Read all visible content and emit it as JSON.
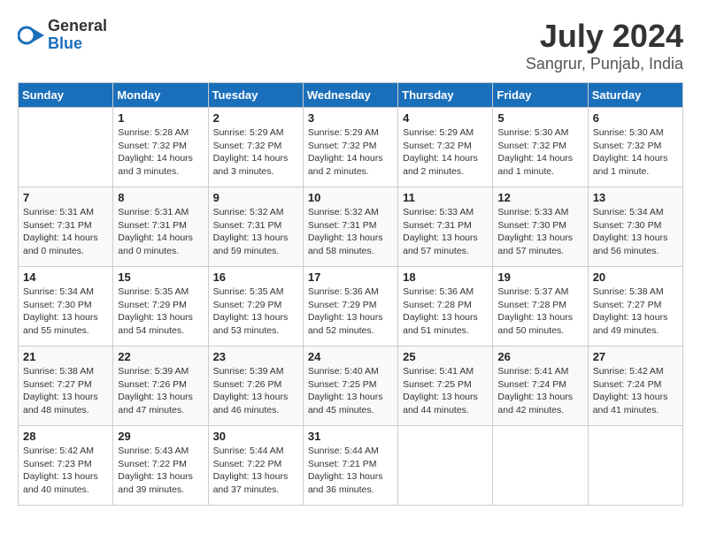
{
  "logo": {
    "general": "General",
    "blue": "Blue"
  },
  "title": "July 2024",
  "subtitle": "Sangrur, Punjab, India",
  "days_of_week": [
    "Sunday",
    "Monday",
    "Tuesday",
    "Wednesday",
    "Thursday",
    "Friday",
    "Saturday"
  ],
  "weeks": [
    [
      {
        "date": "",
        "info": ""
      },
      {
        "date": "1",
        "info": "Sunrise: 5:28 AM\nSunset: 7:32 PM\nDaylight: 14 hours\nand 3 minutes."
      },
      {
        "date": "2",
        "info": "Sunrise: 5:29 AM\nSunset: 7:32 PM\nDaylight: 14 hours\nand 3 minutes."
      },
      {
        "date": "3",
        "info": "Sunrise: 5:29 AM\nSunset: 7:32 PM\nDaylight: 14 hours\nand 2 minutes."
      },
      {
        "date": "4",
        "info": "Sunrise: 5:29 AM\nSunset: 7:32 PM\nDaylight: 14 hours\nand 2 minutes."
      },
      {
        "date": "5",
        "info": "Sunrise: 5:30 AM\nSunset: 7:32 PM\nDaylight: 14 hours\nand 1 minute."
      },
      {
        "date": "6",
        "info": "Sunrise: 5:30 AM\nSunset: 7:32 PM\nDaylight: 14 hours\nand 1 minute."
      }
    ],
    [
      {
        "date": "7",
        "info": "Sunrise: 5:31 AM\nSunset: 7:31 PM\nDaylight: 14 hours\nand 0 minutes."
      },
      {
        "date": "8",
        "info": "Sunrise: 5:31 AM\nSunset: 7:31 PM\nDaylight: 14 hours\nand 0 minutes."
      },
      {
        "date": "9",
        "info": "Sunrise: 5:32 AM\nSunset: 7:31 PM\nDaylight: 13 hours\nand 59 minutes."
      },
      {
        "date": "10",
        "info": "Sunrise: 5:32 AM\nSunset: 7:31 PM\nDaylight: 13 hours\nand 58 minutes."
      },
      {
        "date": "11",
        "info": "Sunrise: 5:33 AM\nSunset: 7:31 PM\nDaylight: 13 hours\nand 57 minutes."
      },
      {
        "date": "12",
        "info": "Sunrise: 5:33 AM\nSunset: 7:30 PM\nDaylight: 13 hours\nand 57 minutes."
      },
      {
        "date": "13",
        "info": "Sunrise: 5:34 AM\nSunset: 7:30 PM\nDaylight: 13 hours\nand 56 minutes."
      }
    ],
    [
      {
        "date": "14",
        "info": "Sunrise: 5:34 AM\nSunset: 7:30 PM\nDaylight: 13 hours\nand 55 minutes."
      },
      {
        "date": "15",
        "info": "Sunrise: 5:35 AM\nSunset: 7:29 PM\nDaylight: 13 hours\nand 54 minutes."
      },
      {
        "date": "16",
        "info": "Sunrise: 5:35 AM\nSunset: 7:29 PM\nDaylight: 13 hours\nand 53 minutes."
      },
      {
        "date": "17",
        "info": "Sunrise: 5:36 AM\nSunset: 7:29 PM\nDaylight: 13 hours\nand 52 minutes."
      },
      {
        "date": "18",
        "info": "Sunrise: 5:36 AM\nSunset: 7:28 PM\nDaylight: 13 hours\nand 51 minutes."
      },
      {
        "date": "19",
        "info": "Sunrise: 5:37 AM\nSunset: 7:28 PM\nDaylight: 13 hours\nand 50 minutes."
      },
      {
        "date": "20",
        "info": "Sunrise: 5:38 AM\nSunset: 7:27 PM\nDaylight: 13 hours\nand 49 minutes."
      }
    ],
    [
      {
        "date": "21",
        "info": "Sunrise: 5:38 AM\nSunset: 7:27 PM\nDaylight: 13 hours\nand 48 minutes."
      },
      {
        "date": "22",
        "info": "Sunrise: 5:39 AM\nSunset: 7:26 PM\nDaylight: 13 hours\nand 47 minutes."
      },
      {
        "date": "23",
        "info": "Sunrise: 5:39 AM\nSunset: 7:26 PM\nDaylight: 13 hours\nand 46 minutes."
      },
      {
        "date": "24",
        "info": "Sunrise: 5:40 AM\nSunset: 7:25 PM\nDaylight: 13 hours\nand 45 minutes."
      },
      {
        "date": "25",
        "info": "Sunrise: 5:41 AM\nSunset: 7:25 PM\nDaylight: 13 hours\nand 44 minutes."
      },
      {
        "date": "26",
        "info": "Sunrise: 5:41 AM\nSunset: 7:24 PM\nDaylight: 13 hours\nand 42 minutes."
      },
      {
        "date": "27",
        "info": "Sunrise: 5:42 AM\nSunset: 7:24 PM\nDaylight: 13 hours\nand 41 minutes."
      }
    ],
    [
      {
        "date": "28",
        "info": "Sunrise: 5:42 AM\nSunset: 7:23 PM\nDaylight: 13 hours\nand 40 minutes."
      },
      {
        "date": "29",
        "info": "Sunrise: 5:43 AM\nSunset: 7:22 PM\nDaylight: 13 hours\nand 39 minutes."
      },
      {
        "date": "30",
        "info": "Sunrise: 5:44 AM\nSunset: 7:22 PM\nDaylight: 13 hours\nand 37 minutes."
      },
      {
        "date": "31",
        "info": "Sunrise: 5:44 AM\nSunset: 7:21 PM\nDaylight: 13 hours\nand 36 minutes."
      },
      {
        "date": "",
        "info": ""
      },
      {
        "date": "",
        "info": ""
      },
      {
        "date": "",
        "info": ""
      }
    ]
  ]
}
